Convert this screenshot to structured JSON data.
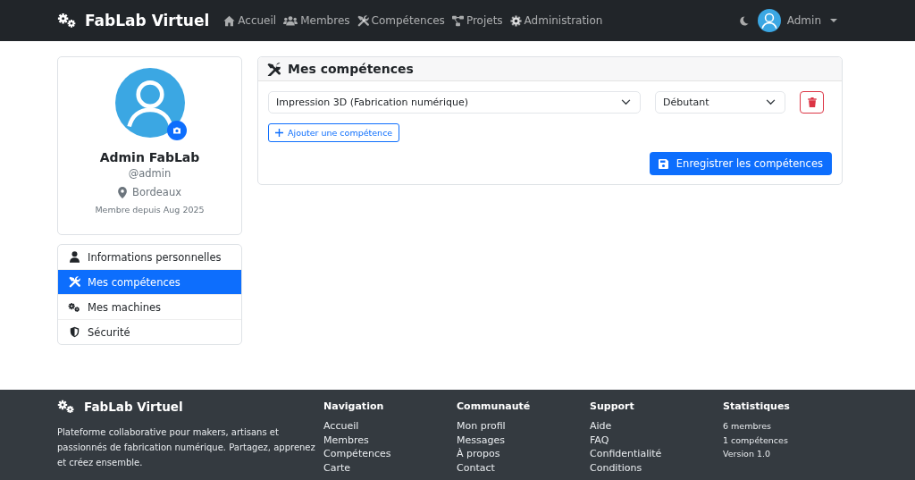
{
  "navbar": {
    "brand": "FabLab Virtuel",
    "links": [
      {
        "label": "Accueil"
      },
      {
        "label": "Membres"
      },
      {
        "label": "Compétences"
      },
      {
        "label": "Projets"
      },
      {
        "label": "Administration"
      }
    ],
    "user": "Admin"
  },
  "profile": {
    "name": "Admin FabLab",
    "username": "@admin",
    "location": "Bordeaux",
    "member_since": "Membre depuis Aug 2025"
  },
  "side_menu": [
    {
      "label": "Informations personnelles",
      "selected": false
    },
    {
      "label": "Mes compétences",
      "selected": true
    },
    {
      "label": "Mes machines",
      "selected": false
    },
    {
      "label": "Sécurité",
      "selected": false
    }
  ],
  "skills_card": {
    "title": "Mes compétences",
    "rows": [
      {
        "skill": "Impression 3D (Fabrication numérique)",
        "level": "Débutant"
      }
    ],
    "add_button": "Ajouter une compétence",
    "save_button": "Enregistrer les compétences"
  },
  "footer": {
    "brand": "FabLab Virtuel",
    "description": "Plateforme collaborative pour makers, artisans et passionnés de fabrication numérique. Partagez, apprenez et créez ensemble.",
    "columns": [
      {
        "kind": "links",
        "heading": "Navigation",
        "items": [
          "Accueil",
          "Membres",
          "Compétences",
          "Carte"
        ]
      },
      {
        "kind": "links",
        "heading": "Communauté",
        "items": [
          "Mon profil",
          "Messages",
          "À propos",
          "Contact"
        ]
      },
      {
        "kind": "links",
        "heading": "Support",
        "items": [
          "Aide",
          "FAQ",
          "Confidentialité",
          "Conditions"
        ]
      },
      {
        "kind": "stats",
        "heading": "Statistiques",
        "items": [
          "6 membres",
          "1 compétences",
          "Version 1.0"
        ]
      }
    ]
  }
}
